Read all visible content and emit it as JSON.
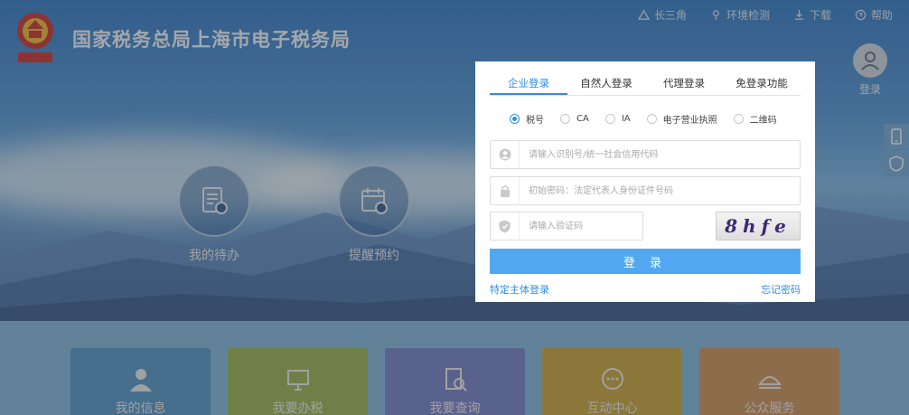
{
  "header": {
    "logo_text": "上海税务",
    "title": "国家税务总局上海市电子税务局",
    "nav": [
      {
        "label": "长三角",
        "icon": "triangle-icon"
      },
      {
        "label": "环境检测",
        "icon": "pin-icon"
      },
      {
        "label": "下载",
        "icon": "download-icon"
      },
      {
        "label": "帮助",
        "icon": "help-icon"
      }
    ],
    "user_label": "登录"
  },
  "hero": {
    "tiles": [
      {
        "label": "我的待办",
        "icon": "todo-icon"
      },
      {
        "label": "提醒预约",
        "icon": "calendar-icon"
      }
    ]
  },
  "bottom_tiles": [
    {
      "label": "我的信息",
      "icon": "user-icon",
      "color": "#4f93c8"
    },
    {
      "label": "我要办税",
      "icon": "monitor-icon",
      "color": "#93b252"
    },
    {
      "label": "我要查询",
      "icon": "search-doc-icon",
      "color": "#6f7ec8"
    },
    {
      "label": "互动中心",
      "icon": "chat-icon",
      "color": "#c4a33a"
    },
    {
      "label": "公众服务",
      "icon": "service-icon",
      "color": "#c98f59"
    }
  ],
  "login": {
    "tabs": [
      {
        "label": "企业登录",
        "active": true
      },
      {
        "label": "自然人登录",
        "active": false
      },
      {
        "label": "代理登录",
        "active": false
      },
      {
        "label": "免登录功能",
        "active": false
      }
    ],
    "login_types": [
      {
        "label": "税号",
        "checked": true
      },
      {
        "label": "CA",
        "checked": false
      },
      {
        "label": "IA",
        "checked": false
      },
      {
        "label": "电子营业执照",
        "checked": false
      },
      {
        "label": "二维码",
        "checked": false
      }
    ],
    "tax_id_placeholder": "请输入识别号/统一社会信用代码",
    "password_placeholder": "初始密码：法定代表人身份证件号码",
    "captcha_placeholder": "请输入验证码",
    "captcha_text": "8hfe",
    "submit_label": "登 录",
    "special_login_link": "特定主体登录",
    "forgot_password_link": "忘记密码"
  },
  "colors": {
    "accent": "#2f8ee0",
    "button": "#52a8f0"
  }
}
